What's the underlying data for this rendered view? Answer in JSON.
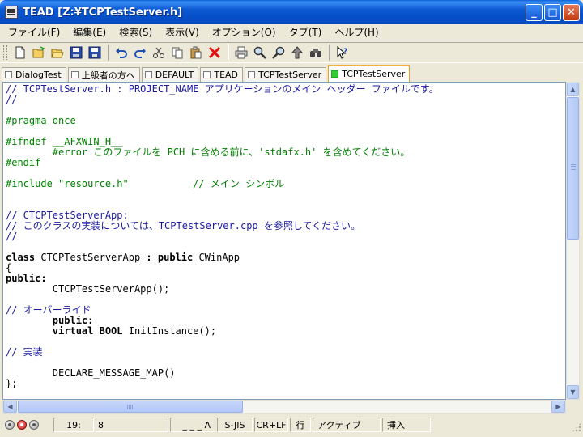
{
  "window": {
    "title": "TEAD  [Z:¥TCPTestServer.h]",
    "minimize": "_",
    "maximize": "□",
    "close": "✕"
  },
  "menu": [
    "ファイル(F)",
    "編集(E)",
    "検索(S)",
    "表示(V)",
    "オプション(O)",
    "タブ(T)",
    "ヘルプ(H)"
  ],
  "toolbar": {
    "groups": [
      [
        "new-icon",
        "open-icon",
        "open-folder-icon",
        "save-icon",
        "save-all-icon"
      ],
      [
        "undo-icon",
        "redo-icon",
        "cut-icon",
        "copy-icon",
        "paste-icon",
        "delete-icon"
      ],
      [
        "print-icon",
        "find-icon",
        "find-next-icon",
        "jump-icon",
        "binoculars-icon"
      ],
      [
        "help-cursor-icon"
      ]
    ]
  },
  "tabs": [
    {
      "label": "DialogTest",
      "active": false
    },
    {
      "label": "上級者の方へ",
      "active": false
    },
    {
      "label": "DEFAULT",
      "active": false
    },
    {
      "label": "TEAD",
      "active": false
    },
    {
      "label": "TCPTestServer",
      "active": false
    },
    {
      "label": "TCPTestServer",
      "active": true
    }
  ],
  "code_lines": [
    [
      {
        "t": "// TCPTestServer.h : PROJECT_NAME アプリケーションのメイン ヘッダー ファイルです。",
        "c": "cm"
      }
    ],
    [
      {
        "t": "//",
        "c": "cm"
      }
    ],
    [],
    [
      {
        "t": "#pragma once",
        "c": "pp"
      }
    ],
    [],
    [
      {
        "t": "#ifndef __AFXWIN_H__",
        "c": "pp"
      }
    ],
    [
      {
        "t": "        #error このファイルを PCH に含める前に、'stdafx.h' を含めてください。",
        "c": "pp"
      }
    ],
    [
      {
        "t": "#endif",
        "c": "pp"
      }
    ],
    [],
    [
      {
        "t": "#include \"resource.h\"           ",
        "c": "pp"
      },
      {
        "t": "// メイン シンボル",
        "c": "pp"
      }
    ],
    [],
    [],
    [
      {
        "t": "// CTCPTestServerApp:",
        "c": "cm"
      }
    ],
    [
      {
        "t": "// このクラスの実装については、TCPTestServer.cpp を参照してください。",
        "c": "cm"
      }
    ],
    [
      {
        "t": "//",
        "c": "cm"
      }
    ],
    [],
    [
      {
        "t": "class",
        "c": "kw"
      },
      {
        "t": " CTCPTestServerApp ",
        "c": "tx"
      },
      {
        "t": ":",
        "c": "kw"
      },
      {
        "t": " ",
        "c": "tx"
      },
      {
        "t": "public",
        "c": "kw"
      },
      {
        "t": " CWinApp",
        "c": "tx"
      }
    ],
    [
      {
        "t": "{",
        "c": "tx"
      }
    ],
    [
      {
        "t": "public:",
        "c": "kw"
      }
    ],
    [
      {
        "t": "        CTCPTestServerApp();",
        "c": "tx"
      }
    ],
    [],
    [
      {
        "t": "// オーバーライド",
        "c": "cm"
      }
    ],
    [
      {
        "t": "        public:",
        "c": "kw"
      }
    ],
    [
      {
        "t": "        virtual",
        "c": "kw"
      },
      {
        "t": " ",
        "c": "tx"
      },
      {
        "t": "BOOL",
        "c": "kw"
      },
      {
        "t": " InitInstance();",
        "c": "tx"
      }
    ],
    [],
    [
      {
        "t": "// 実装",
        "c": "cm"
      }
    ],
    [],
    [
      {
        "t": "        DECLARE_MESSAGE_MAP()",
        "c": "tx"
      }
    ],
    [
      {
        "t": "};",
        "c": "tx"
      }
    ]
  ],
  "statusbar": {
    "line": "19:",
    "column": "8",
    "mode_indicator": "_ _ _ A",
    "encoding": "S-JIS",
    "line_ending": "CR+LF",
    "unit": "行",
    "state": "アクティブ",
    "insert_mode": "挿入"
  },
  "colors": {
    "comment": "#1a1aa0",
    "preprocessor": "#008000",
    "keyword": "#000000",
    "title_bar": "#0b58d2",
    "active_tab_indicator": "#33cc33"
  }
}
